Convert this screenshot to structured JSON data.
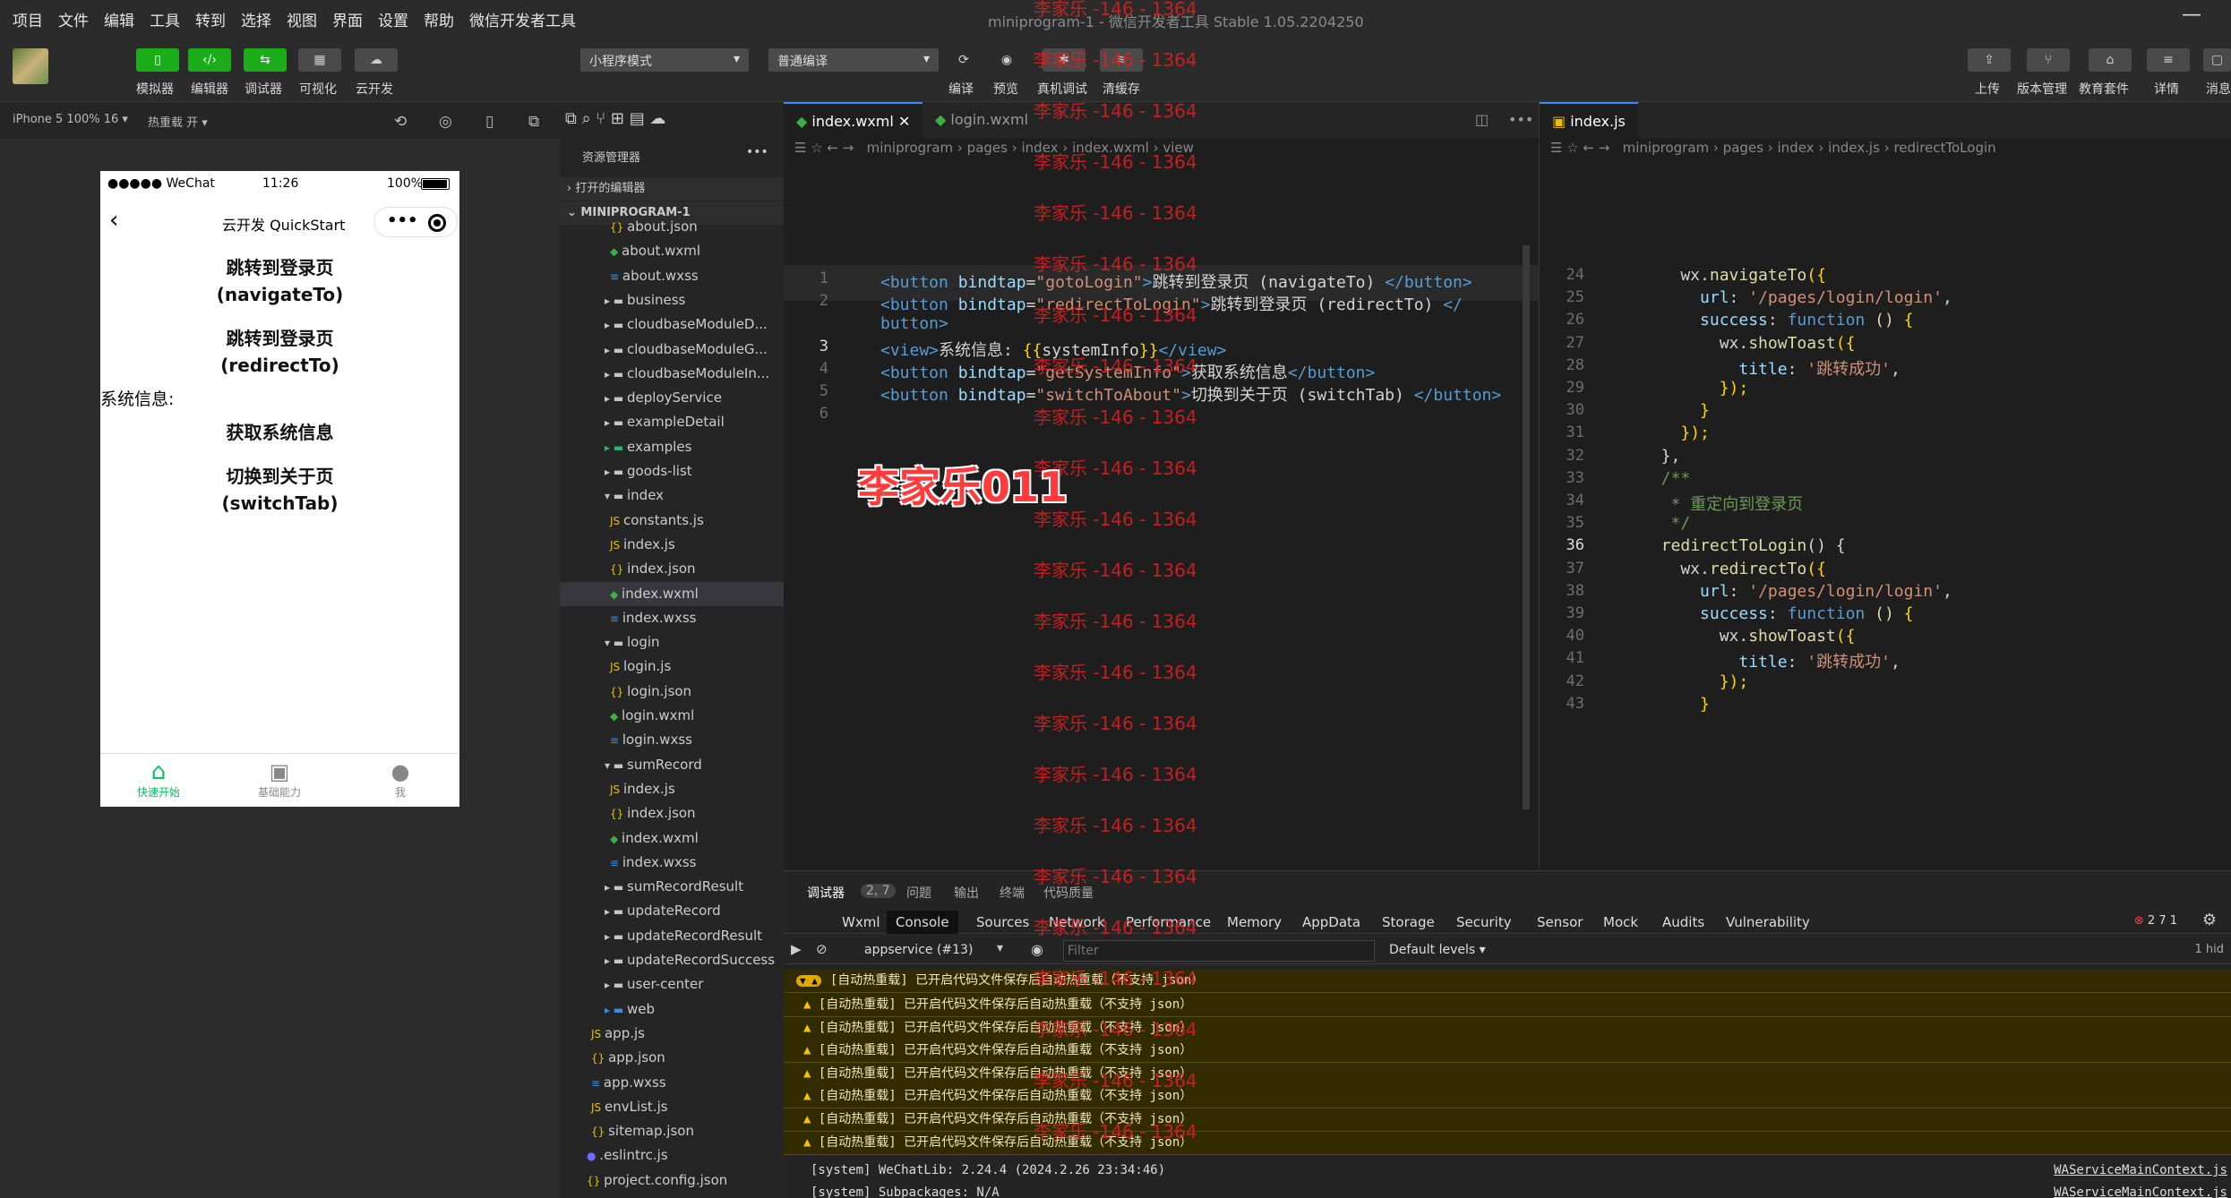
{
  "menu": [
    "项目",
    "文件",
    "编辑",
    "工具",
    "转到",
    "选择",
    "视图",
    "界面",
    "设置",
    "帮助",
    "微信开发者工具"
  ],
  "window_title": "miniprogram-1 - 微信开发者工具 Stable 1.05.2204250",
  "toolbar": {
    "simulator": "模拟器",
    "editor": "编辑器",
    "debugger": "调试器",
    "visual": "可视化",
    "cloud": "云开发",
    "mode": "小程序模式",
    "compile_mode": "普通编译",
    "compile": "编译",
    "preview": "预览",
    "real_debug": "真机调试",
    "clear_cache": "清缓存",
    "upload": "上传",
    "version": "版本管理",
    "edu": "教育套件",
    "details": "详情",
    "messages": "消息"
  },
  "subbar": {
    "device": "iPhone 5 100% 16 ▾",
    "hot_reload": "热重载 开 ▾"
  },
  "phone": {
    "carrier": "●●●●● WeChat",
    "time": "11:26",
    "battery": "100%",
    "nav_title": "云开发 QuickStart",
    "btn1a": "跳转到登录页",
    "btn1b": "(navigateTo)",
    "btn2a": "跳转到登录页",
    "btn2b": "(redirectTo)",
    "sysinfo": "系统信息:",
    "btn3": "获取系统信息",
    "btn4a": "切换到关于页",
    "btn4b": "(switchTab)",
    "tab1": "快速开始",
    "tab2": "基础能力",
    "tab3": "我"
  },
  "explorer": {
    "title": "资源管理器",
    "open_editors": "打开的编辑器",
    "project": "MINIPROGRAM-1",
    "items": [
      {
        "name": "about.json",
        "depth": 3,
        "icon": "json"
      },
      {
        "name": "about.wxml",
        "depth": 3,
        "icon": "wxml"
      },
      {
        "name": "about.wxss",
        "depth": 3,
        "icon": "wxss"
      },
      {
        "name": "business",
        "depth": 2,
        "icon": "folder"
      },
      {
        "name": "cloudbaseModuleD...",
        "depth": 2,
        "icon": "folder"
      },
      {
        "name": "cloudbaseModuleG...",
        "depth": 2,
        "icon": "folder"
      },
      {
        "name": "cloudbaseModuleIn...",
        "depth": 2,
        "icon": "folder"
      },
      {
        "name": "deployService",
        "depth": 2,
        "icon": "folder"
      },
      {
        "name": "exampleDetail",
        "depth": 2,
        "icon": "folder"
      },
      {
        "name": "examples",
        "depth": 2,
        "icon": "folder-g"
      },
      {
        "name": "goods-list",
        "depth": 2,
        "icon": "folder"
      },
      {
        "name": "index",
        "depth": 2,
        "icon": "folder-open"
      },
      {
        "name": "constants.js",
        "depth": 3,
        "icon": "js"
      },
      {
        "name": "index.js",
        "depth": 3,
        "icon": "js"
      },
      {
        "name": "index.json",
        "depth": 3,
        "icon": "json"
      },
      {
        "name": "index.wxml",
        "depth": 3,
        "icon": "wxml"
      },
      {
        "name": "index.wxss",
        "depth": 3,
        "icon": "wxss"
      },
      {
        "name": "login",
        "depth": 2,
        "icon": "folder-open"
      },
      {
        "name": "login.js",
        "depth": 3,
        "icon": "js"
      },
      {
        "name": "login.json",
        "depth": 3,
        "icon": "json"
      },
      {
        "name": "login.wxml",
        "depth": 3,
        "icon": "wxml"
      },
      {
        "name": "login.wxss",
        "depth": 3,
        "icon": "wxss"
      },
      {
        "name": "sumRecord",
        "depth": 2,
        "icon": "folder-open"
      },
      {
        "name": "index.js",
        "depth": 3,
        "icon": "js"
      },
      {
        "name": "index.json",
        "depth": 3,
        "icon": "json"
      },
      {
        "name": "index.wxml",
        "depth": 3,
        "icon": "wxml"
      },
      {
        "name": "index.wxss",
        "depth": 3,
        "icon": "wxss"
      },
      {
        "name": "sumRecordResult",
        "depth": 2,
        "icon": "folder"
      },
      {
        "name": "updateRecord",
        "depth": 2,
        "icon": "folder"
      },
      {
        "name": "updateRecordResult",
        "depth": 2,
        "icon": "folder"
      },
      {
        "name": "updateRecordSuccess",
        "depth": 2,
        "icon": "folder"
      },
      {
        "name": "user-center",
        "depth": 2,
        "icon": "folder"
      },
      {
        "name": "web",
        "depth": 2,
        "icon": "folder-b"
      },
      {
        "name": "app.js",
        "depth": 1,
        "icon": "js"
      },
      {
        "name": "app.json",
        "depth": 1,
        "icon": "json"
      },
      {
        "name": "app.wxss",
        "depth": 1,
        "icon": "wxss"
      },
      {
        "name": "envList.js",
        "depth": 1,
        "icon": "js"
      },
      {
        "name": "sitemap.json",
        "depth": 1,
        "icon": "json"
      },
      {
        "name": ".eslintrc.js",
        "depth": 0,
        "icon": "eslint"
      },
      {
        "name": "project.config.json",
        "depth": 0,
        "icon": "json"
      }
    ]
  },
  "editor1": {
    "tab_active": "index.wxml",
    "tab2": "login.wxml",
    "breadcrumb": [
      "miniprogram",
      "pages",
      "index",
      "index.wxml",
      "view"
    ],
    "lines": [
      {
        "n": "1",
        "segs": [
          [
            "t",
            "<button "
          ],
          [
            "a",
            "bindtap"
          ],
          [
            "",
            "="
          ],
          [
            "s",
            "\"gotoLogin\""
          ],
          [
            "t",
            ">"
          ],
          [
            "",
            "跳转到登录页 (navigateTo) "
          ],
          [
            "t",
            "</button>"
          ]
        ]
      },
      {
        "n": "2",
        "segs": [
          [
            "t",
            "<button "
          ],
          [
            "a",
            "bindtap"
          ],
          [
            "",
            "="
          ],
          [
            "s",
            "\"redirectToLogin\""
          ],
          [
            "t",
            ">"
          ],
          [
            "",
            "跳转到登录页 (redirectTo) "
          ],
          [
            "t",
            "</"
          ]
        ]
      },
      {
        "n": "",
        "segs": [
          [
            "t",
            "button>"
          ]
        ]
      },
      {
        "n": "3",
        "segs": [
          [
            "t",
            "<view>"
          ],
          [
            "",
            "系统信息: "
          ],
          [
            "p",
            "{{"
          ],
          [
            "",
            "systemInfo"
          ],
          [
            "p",
            "}}"
          ],
          [
            "t",
            "</view>"
          ]
        ]
      },
      {
        "n": "4",
        "segs": [
          [
            "t",
            "<button "
          ],
          [
            "a",
            "bindtap"
          ],
          [
            "",
            "="
          ],
          [
            "s",
            "\"getSystemInfo\""
          ],
          [
            "t",
            ">"
          ],
          [
            "",
            "获取系统信息"
          ],
          [
            "t",
            "</button>"
          ]
        ]
      },
      {
        "n": "5",
        "segs": [
          [
            "t",
            "<button "
          ],
          [
            "a",
            "bindtap"
          ],
          [
            "",
            "="
          ],
          [
            "s",
            "\"switchToAbout\""
          ],
          [
            "t",
            ">"
          ],
          [
            "",
            "切换到关于页 (switchTab) "
          ],
          [
            "t",
            "</button>"
          ]
        ]
      },
      {
        "n": "6",
        "segs": []
      }
    ]
  },
  "editor2": {
    "tab": "index.js",
    "breadcrumb": [
      "miniprogram",
      "pages",
      "index",
      "index.js",
      "redirectToLogin"
    ],
    "lines": [
      {
        "n": "24",
        "segs": [
          [
            "",
            "    wx."
          ],
          [
            "f",
            "navigateTo"
          ],
          [
            "p",
            "({"
          ]
        ]
      },
      {
        "n": "25",
        "segs": [
          [
            "",
            "      "
          ],
          [
            "a",
            "url"
          ],
          [
            "",
            ": "
          ],
          [
            "s",
            "'/pages/login/login'"
          ],
          [
            "",
            ","
          ]
        ]
      },
      {
        "n": "26",
        "segs": [
          [
            "",
            "      "
          ],
          [
            "a",
            "success"
          ],
          [
            "",
            ": "
          ],
          [
            "k",
            "function"
          ],
          [
            "f",
            " () "
          ],
          [
            "p",
            "{"
          ]
        ]
      },
      {
        "n": "27",
        "segs": [
          [
            "",
            "        wx."
          ],
          [
            "f",
            "showToast"
          ],
          [
            "p",
            "({"
          ]
        ]
      },
      {
        "n": "28",
        "segs": [
          [
            "",
            "          "
          ],
          [
            "a",
            "title"
          ],
          [
            "",
            ": "
          ],
          [
            "s",
            "'跳转成功'"
          ],
          [
            "",
            ","
          ]
        ]
      },
      {
        "n": "29",
        "segs": [
          [
            "",
            "        "
          ],
          [
            "p",
            "});"
          ]
        ]
      },
      {
        "n": "30",
        "segs": [
          [
            "",
            "      "
          ],
          [
            "p",
            "}"
          ]
        ]
      },
      {
        "n": "31",
        "segs": [
          [
            "",
            "    "
          ],
          [
            "p",
            "});"
          ]
        ]
      },
      {
        "n": "32",
        "segs": [
          [
            "",
            "  },"
          ]
        ]
      },
      {
        "n": "33",
        "segs": [
          [
            "c",
            "  /**"
          ]
        ]
      },
      {
        "n": "34",
        "segs": [
          [
            "c",
            "   * 重定向到登录页"
          ]
        ]
      },
      {
        "n": "35",
        "segs": [
          [
            "c",
            "   */"
          ]
        ]
      },
      {
        "n": "36",
        "segs": [
          [
            "",
            "  "
          ],
          [
            "f",
            "redirectToLogin"
          ],
          [
            "",
            "() {"
          ]
        ]
      },
      {
        "n": "37",
        "segs": [
          [
            "",
            "    wx."
          ],
          [
            "f",
            "redirectTo"
          ],
          [
            "p",
            "({"
          ]
        ]
      },
      {
        "n": "38",
        "segs": [
          [
            "",
            "      "
          ],
          [
            "a",
            "url"
          ],
          [
            "",
            ": "
          ],
          [
            "s",
            "'/pages/login/login'"
          ],
          [
            "",
            ","
          ]
        ]
      },
      {
        "n": "39",
        "segs": [
          [
            "",
            "      "
          ],
          [
            "a",
            "success"
          ],
          [
            "",
            ": "
          ],
          [
            "k",
            "function"
          ],
          [
            "f",
            " () "
          ],
          [
            "p",
            "{"
          ]
        ]
      },
      {
        "n": "40",
        "segs": [
          [
            "",
            "        wx."
          ],
          [
            "f",
            "showToast"
          ],
          [
            "p",
            "({"
          ]
        ]
      },
      {
        "n": "41",
        "segs": [
          [
            "",
            "          "
          ],
          [
            "a",
            "title"
          ],
          [
            "",
            ": "
          ],
          [
            "s",
            "'跳转成功'"
          ],
          [
            "",
            ","
          ]
        ]
      },
      {
        "n": "42",
        "segs": [
          [
            "",
            "        "
          ],
          [
            "p",
            "});"
          ]
        ]
      },
      {
        "n": "43",
        "segs": [
          [
            "",
            "      "
          ],
          [
            "p",
            "}"
          ]
        ]
      }
    ]
  },
  "debug": {
    "tabs": [
      "调试器",
      "2, 7",
      "问题",
      "输出",
      "终端",
      "代码质量"
    ],
    "panels": [
      "Wxml",
      "Console",
      "Sources",
      "Network",
      "Performance",
      "Memory",
      "AppData",
      "Storage",
      "Security",
      "Sensor",
      "Mock",
      "Audits",
      "Vulnerability"
    ],
    "context": "appservice (#13)",
    "filter_placeholder": "Filter",
    "levels": "Default levels ▾",
    "counts": "2  7  1",
    "hidden": "1 hid",
    "group": "[自动热重载] 已开启代码文件保存后自动热重载（不支持 json）",
    "warn": "[自动热重载] 已开启代码文件保存后自动热重载（不支持 json）",
    "sys1": "[system] WeChatLib: 2.24.4 (2024.2.26 23:34:46)",
    "sys2": "[system] Subpackages: N/A",
    "src1": "WAServiceMainContext.js",
    "src2": "WAServiceMainContext.js"
  },
  "watermark": "李家乐 -146 - 1364",
  "big_watermark": "李家乐011"
}
